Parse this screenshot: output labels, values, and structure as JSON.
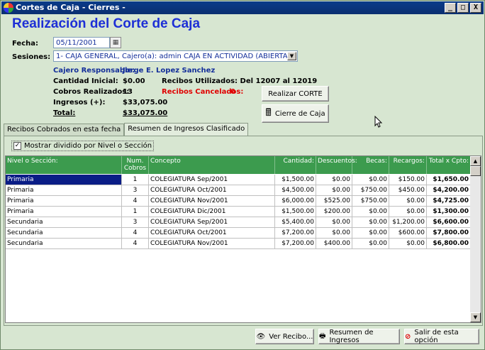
{
  "window": {
    "title": "Cortes de Caja - Cierres -",
    "controls": [
      "_",
      "□",
      "X"
    ]
  },
  "header": {
    "title": "Realización del Corte de Caja"
  },
  "form": {
    "fecha_label": "Fecha:",
    "fecha_value": "05/11/2001",
    "sesiones_label": "Sesiones:",
    "sesiones_value": "1- CAJA GENERAL, Cajero(a): admin   CAJA EN ACTIVIDAD (ABIERTA)"
  },
  "summary": {
    "cajero_label": "Cajero Responsable:",
    "cajero_value": "Jorge E. Lopez Sanchez",
    "cantidad_label": "Cantidad Inicial:",
    "cantidad_value": "$0.00",
    "cobros_label": "Cobros Realizados:",
    "cobros_value": "13",
    "ingresos_label": "Ingresos (+):",
    "ingresos_value": "$33,075.00",
    "total_label": "Total:",
    "total_value": "$33,075.00",
    "recibos_utilizados": "Recibos Utilizados: Del 12007 al 12019",
    "recibos_cancelados_label": "Recibos Cancelados:",
    "recibos_cancelados_value": "0"
  },
  "actions": {
    "realizar_corte": "Realizar CORTE",
    "cierre_caja": "Cierre de Caja"
  },
  "tabs": [
    {
      "label": "Recibos Cobrados en esta fecha"
    },
    {
      "label": "Resumen de Ingresos Clasificado"
    }
  ],
  "options": {
    "mostrar_dividido": "Mostrar dividido por Nivel o Sección"
  },
  "table": {
    "headers": {
      "nivel": "Nivel o Sección:",
      "num": "Num.",
      "cobros": "Cobros",
      "concepto": "Concepto",
      "cantidad": "Cantidad:",
      "descuentos": "Descuentos:",
      "becas": "Becas:",
      "recargos": "Recargos:",
      "total": "Total x Cpto:"
    },
    "rows": [
      [
        "Primaria",
        "1",
        "COLEGIATURA Sep/2001",
        "$1,500.00",
        "$0.00",
        "$0.00",
        "$150.00",
        "$1,650.00"
      ],
      [
        "Primaria",
        "3",
        "COLEGIATURA Oct/2001",
        "$4,500.00",
        "$0.00",
        "$750.00",
        "$450.00",
        "$4,200.00"
      ],
      [
        "Primaria",
        "4",
        "COLEGIATURA Nov/2001",
        "$6,000.00",
        "$525.00",
        "$750.00",
        "$0.00",
        "$4,725.00"
      ],
      [
        "Primaria",
        "1",
        "COLEGIATURA Dic/2001",
        "$1,500.00",
        "$200.00",
        "$0.00",
        "$0.00",
        "$1,300.00"
      ],
      [
        "Secundaria",
        "3",
        "COLEGIATURA Sep/2001",
        "$5,400.00",
        "$0.00",
        "$0.00",
        "$1,200.00",
        "$6,600.00"
      ],
      [
        "Secundaria",
        "4",
        "COLEGIATURA Oct/2001",
        "$7,200.00",
        "$0.00",
        "$0.00",
        "$600.00",
        "$7,800.00"
      ],
      [
        "Secundaria",
        "4",
        "COLEGIATURA Nov/2001",
        "$7,200.00",
        "$400.00",
        "$0.00",
        "$0.00",
        "$6,800.00"
      ]
    ]
  },
  "footer": {
    "ver_recibo": "Ver Recibo...",
    "resumen_ingresos": "Resumen de Ingresos",
    "salir": "Salir de esta opción"
  }
}
